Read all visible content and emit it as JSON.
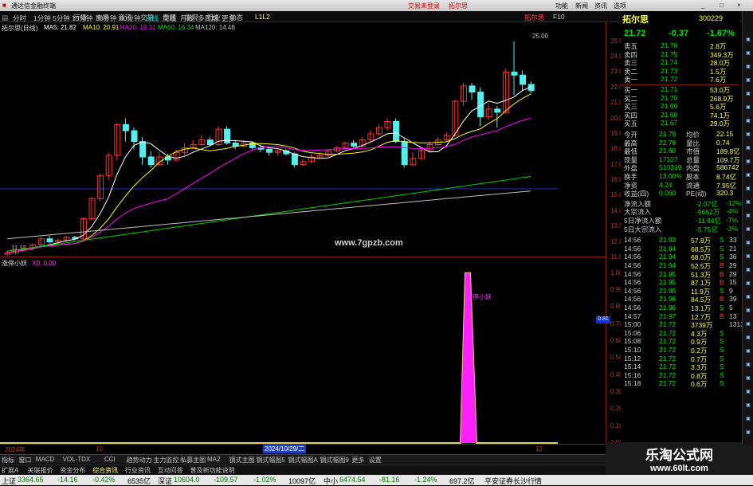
{
  "window": {
    "app_title": "通达信金融终端",
    "center_links": [
      "交易未登录",
      "拓尔思"
    ],
    "right_links": [
      "功能",
      "新闻",
      "资讯",
      "选项"
    ],
    "controls": [
      "_",
      "□",
      "×"
    ]
  },
  "menu": {
    "items": [
      "行情",
      "市场",
      "资讯",
      "交易",
      "专题",
      "发现",
      "行业",
      "动态"
    ],
    "code": "L1L2",
    "periods": [
      "分时",
      "1分钟",
      "5分钟",
      "15分钟",
      "30分钟",
      "60分钟",
      "日线",
      "周线",
      "月线",
      "多周期",
      "更多"
    ],
    "active_period": "日线",
    "icons_right": [
      "F10"
    ]
  },
  "chart": {
    "stock_label": "拓尔思(日线)",
    "ma_legend": [
      {
        "text": "MA5: 21.82",
        "color": "#ffffff"
      },
      {
        "text": "MA10: 20.91",
        "color": "#ffff00"
      },
      {
        "text": "MA20: 19.31",
        "color": "#ff00ff"
      },
      {
        "text": "MA60: 16.34",
        "color": "#00e000"
      },
      {
        "text": "MA120: 14.48",
        "color": "#c0c0c0"
      }
    ],
    "price_ticks": [
      "25.00",
      "24.00",
      "23.00",
      "22.00",
      "21.00",
      "20.00",
      "19.00",
      "18.00",
      "17.00",
      "16.00",
      "15.00",
      "14.00",
      "13.00",
      "12.00",
      "11.00"
    ],
    "high_label": "25.00",
    "low_label": "11.15",
    "watermark": "www.7gpzb.com"
  },
  "indicator": {
    "name": "涨停小妖",
    "value_label": "X0: 0.00",
    "ticks": [
      "1.00",
      "0.90",
      "0.80",
      "0.70",
      "0.60",
      "0.50",
      "0.40",
      "0.30",
      "0.20",
      "0.10",
      "0.00"
    ],
    "current": "0.81",
    "signal_label": "涨停小妖",
    "dates": [
      "2024年",
      "10",
      "2024/10/29/二",
      "12"
    ]
  },
  "quote": {
    "name": "拓尔思",
    "code": "300229",
    "price": "21.72",
    "change": "-0.37",
    "pct": "-1.67%",
    "asks": [
      [
        "卖五",
        "21.76",
        "2.8万"
      ],
      [
        "卖四",
        "21.75",
        "349.3万"
      ],
      [
        "卖三",
        "21.74",
        "28.0万"
      ],
      [
        "卖二",
        "21.73",
        "1.5万"
      ],
      [
        "卖一",
        "21.72",
        "7.6万"
      ]
    ],
    "bids": [
      [
        "买一",
        "21.71",
        "53.0万"
      ],
      [
        "买二",
        "21.70",
        "268.9万"
      ],
      [
        "买三",
        "21.69",
        "5.6万"
      ],
      [
        "买四",
        "21.68",
        "74.1万"
      ],
      [
        "买五",
        "21.67",
        "29.0万"
      ]
    ],
    "stats": [
      [
        "今开",
        "21.79",
        "均价",
        "22.15"
      ],
      [
        "最高",
        "22.76",
        "量比",
        "0.74"
      ],
      [
        "最低",
        "21.60",
        "市值",
        "189.8亿"
      ],
      [
        "现量",
        "17107",
        "总量",
        "109.7万"
      ],
      [
        "外盘",
        "510319",
        "内盘",
        "586742"
      ],
      [
        "换手",
        "13.00%",
        "股本",
        "8.74亿"
      ],
      [
        "净资",
        "4.24",
        "流通",
        "7.95亿"
      ],
      [
        "收益(四)",
        "0.060",
        "PE(动)",
        "320.3"
      ]
    ],
    "flows": [
      [
        "净流入额",
        "-2.07亿",
        "-12%"
      ],
      [
        "大宗流入",
        "-9662万",
        "-4%"
      ],
      [
        "5日净流入额",
        "-11.64亿",
        "-7%"
      ],
      [
        "5日大宗流入",
        "-5.75亿",
        "-3%"
      ]
    ],
    "ticks": [
      [
        "14:56",
        "21.93",
        "57.8万",
        "S",
        "33"
      ],
      [
        "14:56",
        "21.94",
        "68.5万",
        "S",
        "21"
      ],
      [
        "14:56",
        "21.94",
        "68.0万",
        "S",
        "36"
      ],
      [
        "14:56",
        "21.94",
        "52.5万",
        "B",
        "29"
      ],
      [
        "14:56",
        "21.95",
        "51.3万",
        "B",
        "29"
      ],
      [
        "14:56",
        "21.95",
        "87.1万",
        "B",
        "15"
      ],
      [
        "14:56",
        "21.95",
        "11.9万",
        "S",
        "9"
      ],
      [
        "14:56",
        "21.96",
        "84.5万",
        "B",
        "39"
      ],
      [
        "14:56",
        "21.96",
        "13.1万",
        "S",
        "5"
      ],
      [
        "14:57",
        "21.97",
        "12.7万",
        "B",
        "13"
      ],
      [
        "15:00",
        "21.72",
        "3739万",
        "",
        "1313"
      ],
      [
        "15:06",
        "21.72",
        "4.3万",
        "S",
        ""
      ],
      [
        "15:08",
        "21.72",
        "0.9万",
        "S",
        ""
      ],
      [
        "15:10",
        "21.72",
        "0.2万",
        "S",
        ""
      ],
      [
        "15:12",
        "21.72",
        "0.7万",
        "S",
        ""
      ],
      [
        "15:14",
        "21.72",
        "3.3万",
        "S",
        ""
      ],
      [
        "15:16",
        "21.72",
        "0.8万",
        "S",
        ""
      ],
      [
        "15:18",
        "21.72",
        "0.6万",
        "S",
        ""
      ]
    ]
  },
  "tabs": [
    "扩展A",
    "关联报价",
    "资金分布",
    "综合资讯",
    "行业资讯",
    "互动问答",
    "普及新功能说明"
  ],
  "tabs2": [
    "指标",
    "窗口",
    "MACD",
    "VOL-TDX",
    "CCI",
    "趋势动力",
    "主力监控",
    "私募主图",
    "MA2",
    "钢式主图",
    "钢式幅图5",
    "钢式幅图A",
    "钢式幅图9",
    "更多",
    "设置"
  ],
  "status": {
    "items": [
      {
        "t": "上证",
        "c": "wh"
      },
      {
        "t": "3364.65",
        "c": "dn"
      },
      {
        "t": "-14.16",
        "c": "dn"
      },
      {
        "t": "-0.42%",
        "c": "dn"
      },
      {
        "t": "6535亿",
        "c": "wh"
      },
      {
        "t": "深证",
        "c": "wh"
      },
      {
        "t": "10604.0",
        "c": "dn"
      },
      {
        "t": "-109.57",
        "c": "dn"
      },
      {
        "t": "-1.02%",
        "c": "dn"
      },
      {
        "t": "10097亿",
        "c": "wh"
      },
      {
        "t": "中小",
        "c": "wh"
      },
      {
        "t": "6474.54",
        "c": "dn"
      },
      {
        "t": "-81.16",
        "c": "dn"
      },
      {
        "t": "-1.24%",
        "c": "dn"
      },
      {
        "t": "697.2亿",
        "c": "wh"
      },
      {
        "t": "平安证券长沙行情",
        "c": "wh"
      }
    ]
  },
  "brand": {
    "title": "乐淘公式网",
    "url": "www.60lt.com"
  }
}
